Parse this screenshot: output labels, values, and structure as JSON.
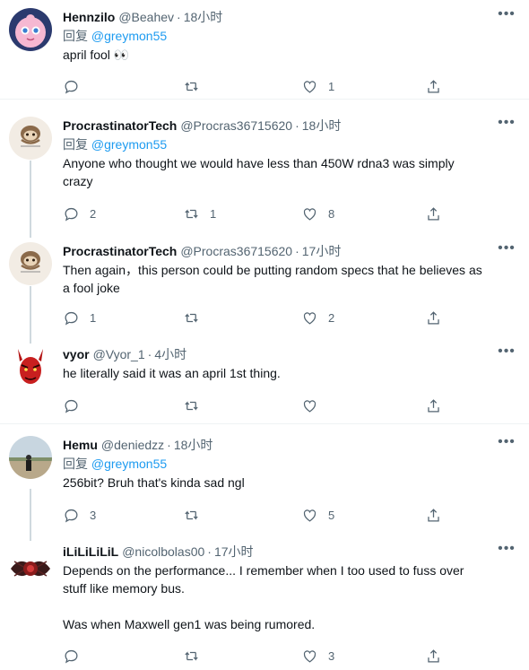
{
  "reply_prefix": "回复",
  "tweets": [
    {
      "name": "Hennzilo",
      "handle": "@Beahev",
      "time": "18小时",
      "reply_to": "@greymon55",
      "text": [
        "april fool 👀"
      ],
      "replies": "",
      "retweets": "",
      "likes": "1"
    },
    {
      "name": "ProcrastinatorTech",
      "handle": "@Procras36715620",
      "time": "18小时",
      "reply_to": "@greymon55",
      "text": [
        "Anyone who thought we would have less than 450W rdna3 was simply",
        "crazy"
      ],
      "replies": "2",
      "retweets": "1",
      "likes": "8"
    },
    {
      "name": "ProcrastinatorTech",
      "handle": "@Procras36715620",
      "time": "17小时",
      "reply_to": "",
      "text": [
        "Then again，this person could be putting random specs that he believes as",
        "a fool joke"
      ],
      "replies": "1",
      "retweets": "",
      "likes": "2"
    },
    {
      "name": "vyor",
      "handle": "@Vyor_1",
      "time": "4小时",
      "reply_to": "",
      "text": [
        "he literally said it was an april 1st thing."
      ],
      "replies": "",
      "retweets": "",
      "likes": ""
    },
    {
      "name": "Hemu",
      "handle": "@deniedzz",
      "time": "18小时",
      "reply_to": "@greymon55",
      "text": [
        "256bit? Bruh that's kinda sad ngl"
      ],
      "replies": "3",
      "retweets": "",
      "likes": "5"
    },
    {
      "name": "iLiLiLiLiL",
      "handle": "@nicolbolas00",
      "time": "17小时",
      "reply_to": "",
      "text": [
        "Depends on the performance... I remember when I too used to fuss over",
        "stuff like memory bus.",
        "",
        "Was when Maxwell gen1 was being rumored."
      ],
      "replies": "",
      "retweets": "",
      "likes": "3"
    }
  ],
  "colors": {
    "text": "#0f1419",
    "secondary": "#536471",
    "link": "#1d9bf0",
    "divider": "#eff3f4",
    "thread_line": "#cfd9de"
  },
  "icons": [
    "reply-icon",
    "retweet-icon",
    "like-icon",
    "share-icon",
    "more-icon"
  ]
}
